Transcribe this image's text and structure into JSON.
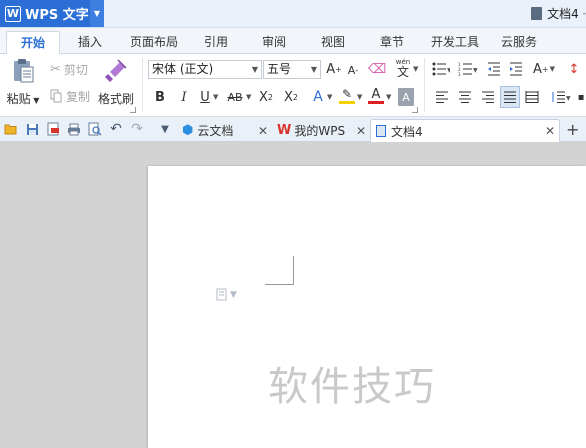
{
  "titlebar": {
    "app_name": "WPS 文字",
    "logo_letter": "W",
    "doc_title": "文档4"
  },
  "menu_tabs": [
    "开始",
    "插入",
    "页面布局",
    "引用",
    "审阅",
    "视图",
    "章节",
    "开发工具",
    "云服务"
  ],
  "ribbon": {
    "paste": "粘贴",
    "cut": "剪切",
    "copy": "复制",
    "format_painter": "格式刷",
    "font_name": "宋体 (正文)",
    "font_size": "五号",
    "grow_font": "A",
    "shrink_font": "A",
    "bold": "B",
    "italic": "I",
    "underline": "U",
    "strikethrough": "AB",
    "superscript": "X",
    "subscript": "X",
    "pinyin_top": "wén",
    "pinyin_char": "文",
    "text_effect": "A",
    "font_color": "A",
    "char_shade": "A",
    "text_style": "A"
  },
  "doc_tabs": [
    {
      "label": "云文档"
    },
    {
      "label": "我的WPS"
    },
    {
      "label": "文档4"
    }
  ],
  "watermark": "软件技巧",
  "colors": {
    "accent": "#2b6fd6",
    "highlight": "#f5d000",
    "font_color": "#e02020",
    "wps_red": "#d9342b"
  }
}
